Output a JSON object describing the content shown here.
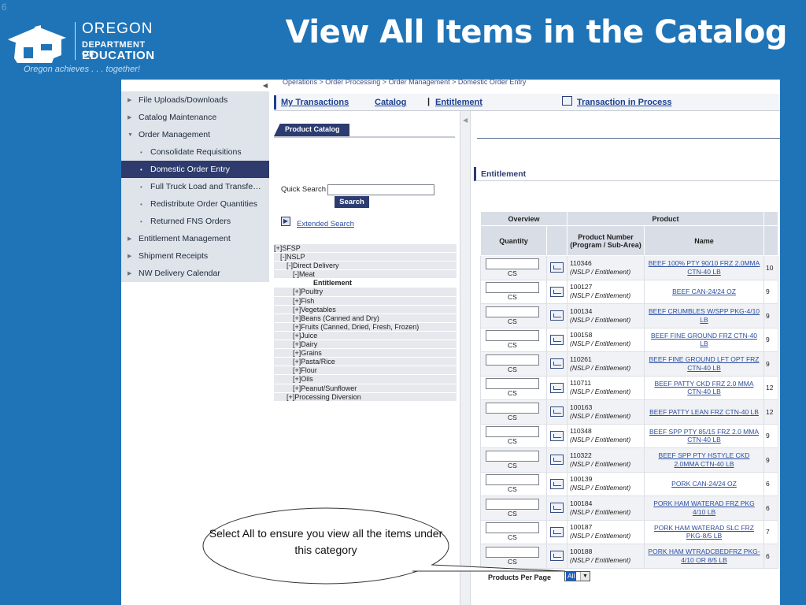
{
  "slide_number": "6",
  "slide_title": "View All Items in the Catalog",
  "logo": {
    "line1": "OREGON",
    "line2": "DEPARTMENT OF",
    "line3": "EDUCATION",
    "tagline": "Oregon achieves . . . together!"
  },
  "breadcrumb": "Operations  >  Order Processing  >  Order Management  >  Domestic Order Entry",
  "nav": [
    {
      "label": "File Uploads/Downloads",
      "type": "top",
      "icon": "triangle-right-icon"
    },
    {
      "label": "Catalog Maintenance",
      "type": "top",
      "icon": "triangle-right-icon"
    },
    {
      "label": "Order Management",
      "type": "top",
      "icon": "triangle-down-icon"
    },
    {
      "label": "Consolidate Requisitions",
      "type": "sub",
      "icon": "bullet-icon"
    },
    {
      "label": "Domestic Order Entry",
      "type": "sub",
      "active": true,
      "icon": "bullet-icon"
    },
    {
      "label": "Full Truck Load and Transfe…",
      "type": "sub",
      "icon": "bullet-icon"
    },
    {
      "label": "Redistribute Order Quantities",
      "type": "sub",
      "icon": "bullet-icon"
    },
    {
      "label": "Returned FNS Orders",
      "type": "sub",
      "icon": "bullet-icon"
    },
    {
      "label": "Entitlement Management",
      "type": "top",
      "icon": "triangle-right-icon"
    },
    {
      "label": "Shipment Receipts",
      "type": "top",
      "icon": "triangle-right-icon"
    },
    {
      "label": "NW Delivery Calendar",
      "type": "top",
      "icon": "triangle-right-icon"
    }
  ],
  "topbar": {
    "my_transactions": "My Transactions",
    "catalog": "Catalog",
    "separator": "|",
    "entitlement": "Entitlement",
    "transaction_in_process": "Transaction in Process"
  },
  "product_catalog_tab": "Product Catalog",
  "quick_search_label": "Quick Search",
  "search_button": "Search",
  "extended_search": "Extended Search",
  "tree": [
    {
      "label": "[+]SFSP",
      "indent": 0
    },
    {
      "label": "[-]NSLP",
      "indent": 1
    },
    {
      "label": "[-]Direct Delivery",
      "indent": 2
    },
    {
      "label": "[-]Meat",
      "indent": 3
    },
    {
      "label": "Entitlement",
      "indent": 4,
      "bold": true
    },
    {
      "label": "[+]Poultry",
      "indent": 3
    },
    {
      "label": "[+]Fish",
      "indent": 3
    },
    {
      "label": "[+]Vegetables",
      "indent": 3
    },
    {
      "label": "[+]Beans (Canned and Dry)",
      "indent": 3
    },
    {
      "label": "[+]Fruits (Canned, Dried, Fresh, Frozen)",
      "indent": 3
    },
    {
      "label": "[+]Juice",
      "indent": 3
    },
    {
      "label": "[+]Dairy",
      "indent": 3
    },
    {
      "label": "[+]Grains",
      "indent": 3
    },
    {
      "label": "[+]Pasta/Rice",
      "indent": 3
    },
    {
      "label": "[+]Flour",
      "indent": 3
    },
    {
      "label": "[+]Oils",
      "indent": 3
    },
    {
      "label": "[+]Peanut/Sunflower",
      "indent": 3
    },
    {
      "label": "[+]Processing Diversion",
      "indent": 2
    }
  ],
  "entitlement_title": "Entitlement",
  "table": {
    "group_headers": [
      "Overview",
      "Product"
    ],
    "columns": [
      "Quantity",
      "",
      "Product Number (Program / Sub-Area)",
      "Name"
    ],
    "unit": "CS",
    "rows": [
      {
        "number": "110346",
        "program": "(NSLP / Entitlement)",
        "name": "BEEF 100% PTY 90/10 FRZ 2.0MMA CTN-40 LB",
        "extra": "10"
      },
      {
        "number": "100127",
        "program": "(NSLP / Entitlement)",
        "name": "BEEF CAN-24/24 OZ",
        "extra": "9"
      },
      {
        "number": "100134",
        "program": "(NSLP / Entitlement)",
        "name": "BEEF CRUMBLES W/SPP PKG-4/10 LB",
        "extra": "9"
      },
      {
        "number": "100158",
        "program": "(NSLP / Entitlement)",
        "name": "BEEF FINE GROUND FRZ CTN-40 LB",
        "extra": "9"
      },
      {
        "number": "110261",
        "program": "(NSLP / Entitlement)",
        "name": "BEEF FINE GROUND LFT OPT FRZ CTN-40 LB",
        "extra": "9"
      },
      {
        "number": "110711",
        "program": "(NSLP / Entitlement)",
        "name": "BEEF PATTY CKD FRZ 2.0 MMA CTN-40 LB",
        "extra": "12"
      },
      {
        "number": "100163",
        "program": "(NSLP / Entitlement)",
        "name": "BEEF PATTY LEAN FRZ CTN-40 LB",
        "extra": "12"
      },
      {
        "number": "110348",
        "program": "(NSLP / Entitlement)",
        "name": "BEEF SPP PTY 85/15 FRZ 2.0 MMA CTN-40 LB",
        "extra": "9"
      },
      {
        "number": "110322",
        "program": "(NSLP / Entitlement)",
        "name": "BEEF SPP PTY HSTYLE CKD 2.0MMA CTN-40 LB",
        "extra": "9"
      },
      {
        "number": "100139",
        "program": "(NSLP / Entitlement)",
        "name": "PORK CAN-24/24 OZ",
        "extra": "6"
      },
      {
        "number": "100184",
        "program": "(NSLP / Entitlement)",
        "name": "PORK HAM WATERAD FRZ PKG 4/10 LB",
        "extra": "6"
      },
      {
        "number": "100187",
        "program": "(NSLP / Entitlement)",
        "name": "PORK HAM WATERAD SLC FRZ PKG-8/5 LB",
        "extra": "7"
      },
      {
        "number": "100188",
        "program": "(NSLP / Entitlement)",
        "name": "PORK HAM WTRADCBEDFRZ PKG-4/10 OR 8/5 LB",
        "extra": "6"
      }
    ]
  },
  "products_per_page_label": "Products Per Page",
  "products_per_page_value": "All",
  "callout": "Select All to ensure you view all the items under this category",
  "colors": {
    "slide_bg": "#1f74b8",
    "nav_active": "#2e3b6c",
    "link": "#2a4fa3",
    "header_bg": "#d9dde6"
  }
}
